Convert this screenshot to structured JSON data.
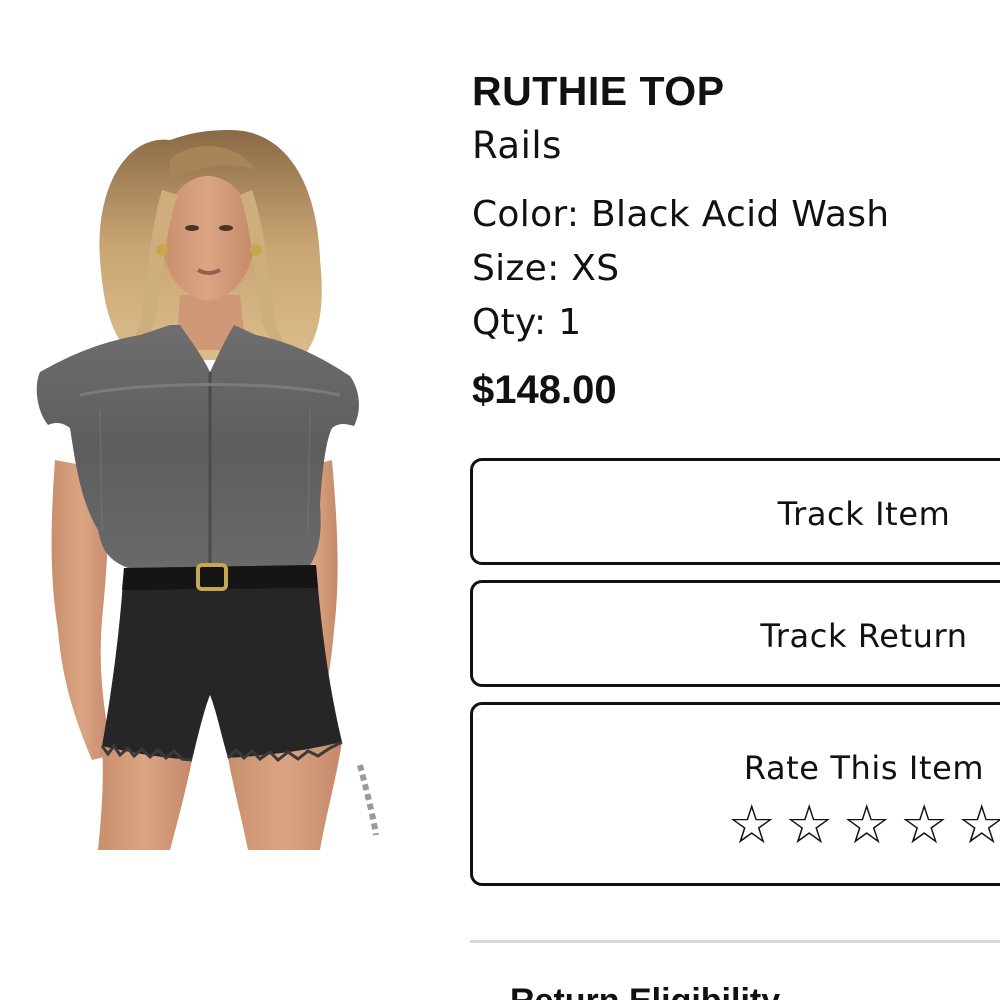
{
  "product": {
    "name": "RUTHIE TOP",
    "brand": "Rails",
    "color_label": "Color:",
    "color_value": "Black Acid Wash",
    "size_label": "Size:",
    "size_value": "XS",
    "qty_label": "Qty:",
    "qty_value": "1",
    "price": "$148.00"
  },
  "actions": {
    "track_item": "Track Item",
    "track_return": "Track Return",
    "rate_item": "Rate This Item"
  },
  "rating": {
    "star_glyph": "☆",
    "max_stars": 5,
    "value": 0
  },
  "sections": {
    "return_eligibility": "Return Eligibility"
  }
}
